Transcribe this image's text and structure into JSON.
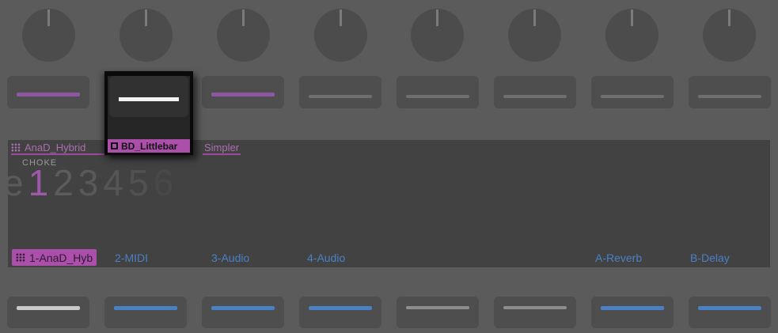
{
  "colors": {
    "magenta_accent": "#ab4fab",
    "magenta_text": "#aa6fae",
    "magenta_underline": "#9c4a9c",
    "purple_slider": "#8e57a4",
    "blue_accent": "#4a80c4",
    "white_line": "#f2f2f2",
    "digit_selected": "#9b59a8"
  },
  "popup": {
    "label": "BD_Littlebar"
  },
  "header": {
    "track_1": "AnaD_Hybrid",
    "track_3": "Simpler"
  },
  "choke": {
    "label": "CHOKE",
    "selected": "1",
    "options": [
      {
        "text": "e"
      },
      {
        "text": "1"
      },
      {
        "text": "2"
      },
      {
        "text": "3"
      },
      {
        "text": "4"
      },
      {
        "text": "5"
      },
      {
        "text": "6"
      }
    ]
  },
  "tabs": {
    "left": [
      {
        "label": "1-AnaD_Hyb",
        "active": true
      },
      {
        "label": "2-MIDI"
      },
      {
        "label": "3-Audio"
      },
      {
        "label": "4-Audio"
      }
    ],
    "right": [
      {
        "label": "A-Reverb"
      },
      {
        "label": "B-Delay"
      }
    ]
  }
}
